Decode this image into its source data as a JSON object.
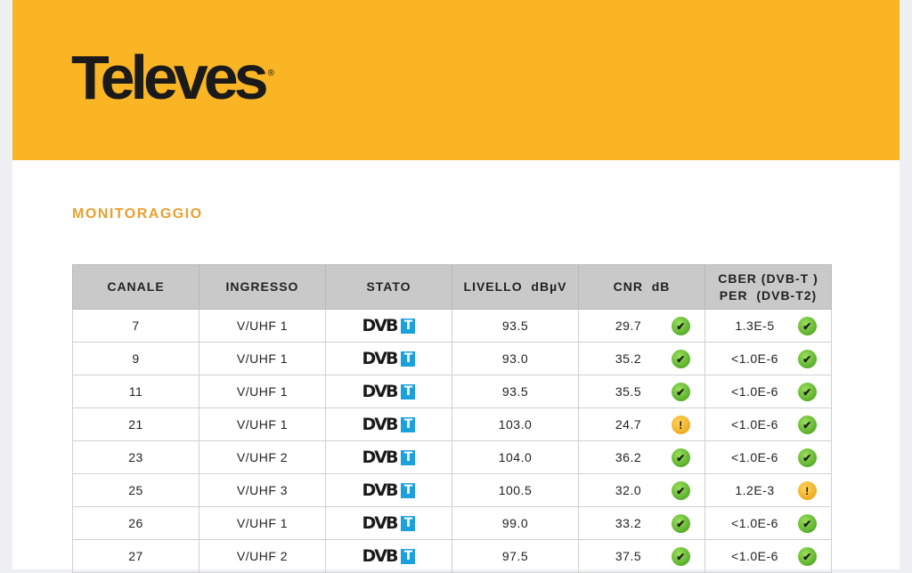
{
  "brand": {
    "logo_text": "Televes",
    "registered": "®"
  },
  "section_title": "MONITORAGGIO",
  "table": {
    "headers": [
      "CANALE",
      "INGRESSO",
      "STATO",
      "LIVELLO  dBµV",
      "CNR  dB",
      "CBER (DVB-T )",
      "PER  (DVB-T2)"
    ],
    "rows": [
      {
        "canale": "7",
        "ingresso": "V/UHF 1",
        "stato": "DVB-T",
        "livello": "93.5",
        "cnr": "29.7",
        "cnr_status": "ok",
        "cber": "1.3E-5",
        "cber_status": "ok"
      },
      {
        "canale": "9",
        "ingresso": "V/UHF 1",
        "stato": "DVB-T",
        "livello": "93.0",
        "cnr": "35.2",
        "cnr_status": "ok",
        "cber": "<1.0E-6",
        "cber_status": "ok"
      },
      {
        "canale": "11",
        "ingresso": "V/UHF 1",
        "stato": "DVB-T",
        "livello": "93.5",
        "cnr": "35.5",
        "cnr_status": "ok",
        "cber": "<1.0E-6",
        "cber_status": "ok"
      },
      {
        "canale": "21",
        "ingresso": "V/UHF 1",
        "stato": "DVB-T",
        "livello": "103.0",
        "cnr": "24.7",
        "cnr_status": "warn",
        "cber": "<1.0E-6",
        "cber_status": "ok"
      },
      {
        "canale": "23",
        "ingresso": "V/UHF 2",
        "stato": "DVB-T",
        "livello": "104.0",
        "cnr": "36.2",
        "cnr_status": "ok",
        "cber": "<1.0E-6",
        "cber_status": "ok"
      },
      {
        "canale": "25",
        "ingresso": "V/UHF 3",
        "stato": "DVB-T",
        "livello": "100.5",
        "cnr": "32.0",
        "cnr_status": "ok",
        "cber": "1.2E-3",
        "cber_status": "warn"
      },
      {
        "canale": "26",
        "ingresso": "V/UHF 1",
        "stato": "DVB-T",
        "livello": "99.0",
        "cnr": "33.2",
        "cnr_status": "ok",
        "cber": "<1.0E-6",
        "cber_status": "ok"
      },
      {
        "canale": "27",
        "ingresso": "V/UHF 2",
        "stato": "DVB-T",
        "livello": "97.5",
        "cnr": "37.5",
        "cnr_status": "ok",
        "cber": "<1.0E-6",
        "cber_status": "ok"
      }
    ]
  },
  "colors": {
    "header_bg": "#f9b523",
    "section": "#e8a02e",
    "ok": "#3f9a1a",
    "warn": "#e89b0a"
  }
}
